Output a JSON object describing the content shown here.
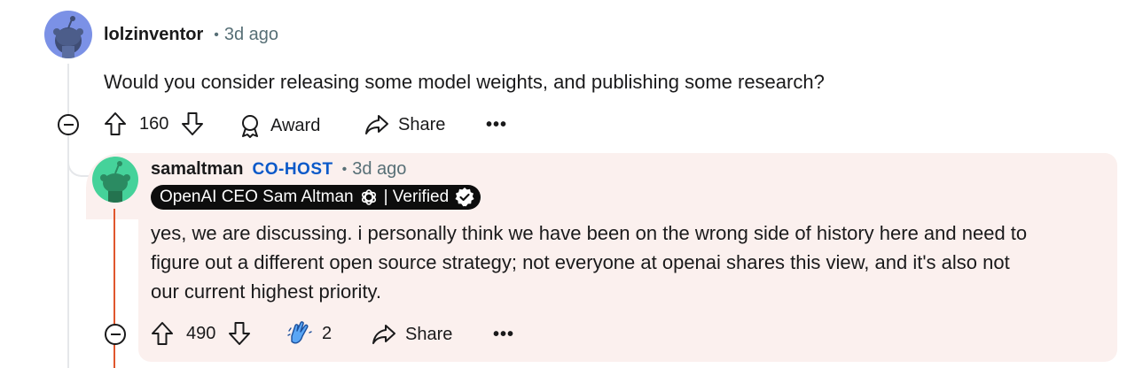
{
  "top_comment": {
    "username": "lolzinventor",
    "separator": "•",
    "time_ago": "3d ago",
    "body": "Would you consider releasing some model weights, and publishing some research?",
    "votes": "160",
    "award_label": "Award",
    "share_label": "Share",
    "more_label": "•••"
  },
  "reply": {
    "username": "samaltman",
    "role_badge": "CO-HOST",
    "separator": "•",
    "time_ago": "3d ago",
    "flair_text": "OpenAI CEO Sam Altman",
    "flair_verified": "| Verified",
    "body_lines": [
      "yes, we are discussing. i personally think we have been on the wrong side of history here and need to",
      "figure out a different open source strategy; not everyone at openai shares this view, and it's also not",
      "our current highest priority."
    ],
    "votes": "490",
    "award_count": "2",
    "share_label": "Share",
    "more_label": "•••"
  },
  "colors": {
    "avatar_top": "#7b91e6",
    "avatar_reply": "#45d29a",
    "reply_bg": "#fbf0ee",
    "thread_line_reply": "#e0562d",
    "cohost": "#0b59c9"
  },
  "icons": [
    "upvote-icon",
    "downvote-icon",
    "award-icon",
    "share-icon",
    "more-icon",
    "collapse-icon",
    "openai-logo-icon",
    "verified-check-icon",
    "clap-hands-icon"
  ]
}
